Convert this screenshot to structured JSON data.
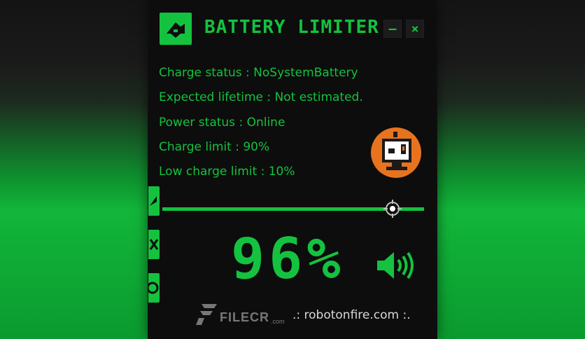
{
  "window": {
    "title": "BATTERY LIMITER",
    "minimize_label": "–",
    "close_label": "×"
  },
  "info": {
    "charge_status": "Charge status : NoSystemBattery",
    "expected_lifetime": "Expected lifetime : Not estimated.",
    "power_status": "Power status : Online",
    "charge_limit": "Charge limit : 90%",
    "low_charge_limit": "Low charge limit : 10%"
  },
  "slider": {
    "value_fraction": 0.9
  },
  "battery": {
    "percent_text": "96%"
  },
  "footer": {
    "link_text": ".: robotonfire.com :."
  },
  "watermark": {
    "text": "FILECR",
    "suffix": ".com"
  },
  "icons": [
    "app-logo-icon",
    "minimize-icon",
    "close-icon",
    "robot-mascot-icon",
    "slider-crosshair-icon",
    "side-tab-leaf-icon",
    "side-tab-tools-icon",
    "side-tab-circle-icon",
    "speaker-icon"
  ],
  "colors": {
    "accent": "#14c23f",
    "window_bg": "#0d0d0d",
    "mascot": "#e8731f",
    "link": "#d8d8d8"
  }
}
